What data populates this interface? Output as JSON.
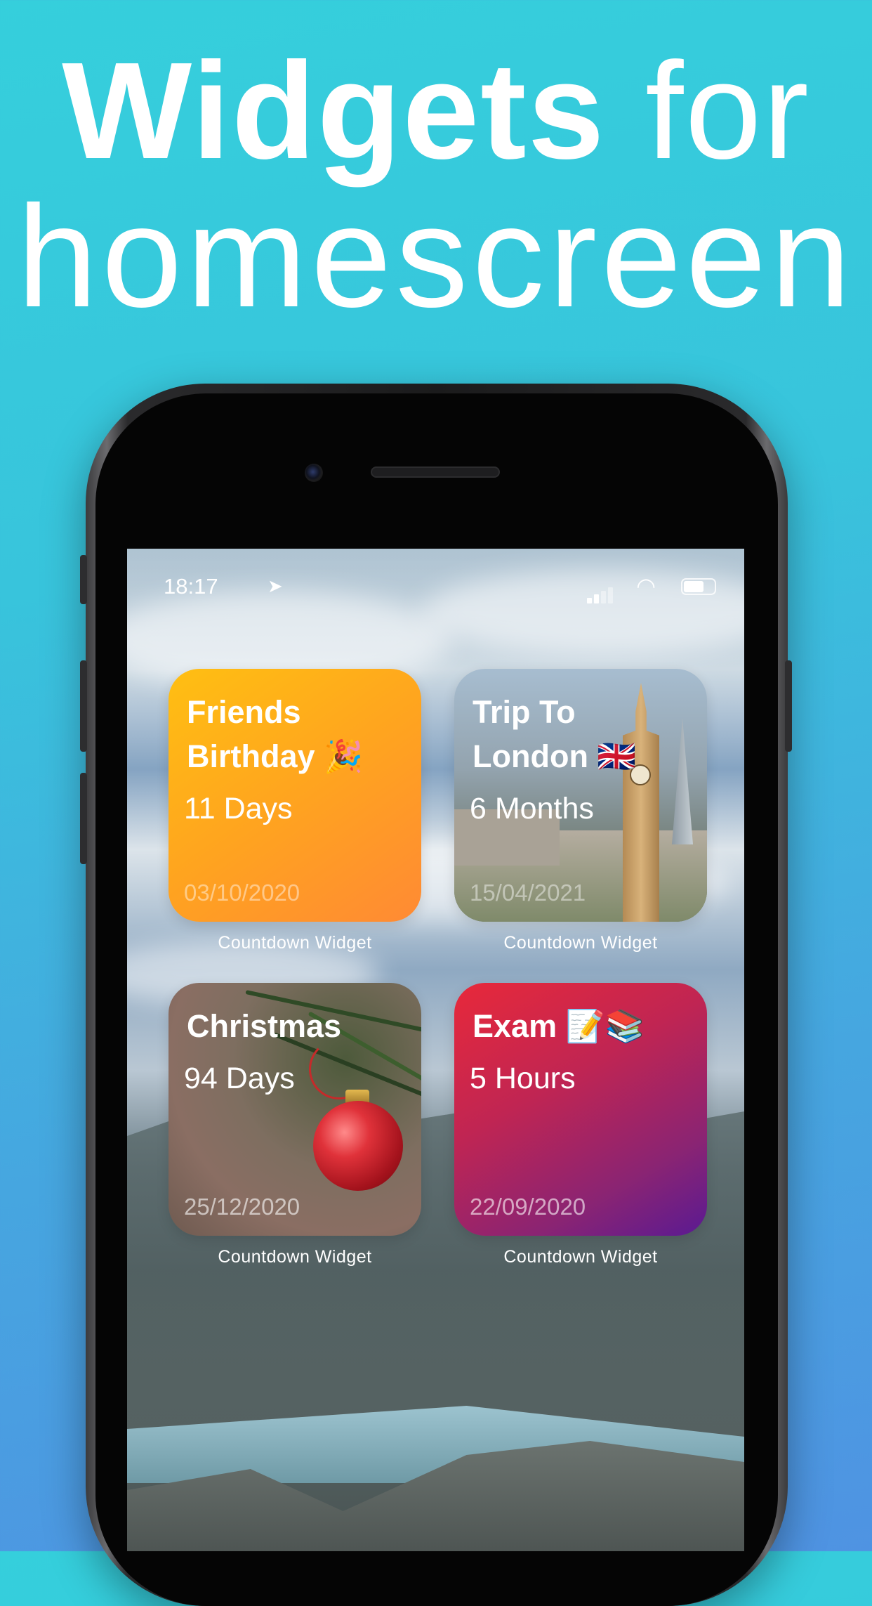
{
  "headline": {
    "bold": "Widgets",
    "regular": "for",
    "line2": "homescreen"
  },
  "status_bar": {
    "time": "18:17"
  },
  "widgets": [
    {
      "title_line1": "Friends",
      "title_line2": "Birthday 🎉",
      "count": "11 Days",
      "date": "03/10/2020",
      "caption": "Countdown Widget"
    },
    {
      "title_line1": "Trip To",
      "title_line2": "London 🇬🇧",
      "count": "6 Months",
      "date": "15/04/2021",
      "caption": "Countdown Widget"
    },
    {
      "title_line1": "Christmas",
      "title_line2": "",
      "count": "94 Days",
      "date": "25/12/2020",
      "caption": "Countdown Widget"
    },
    {
      "title_line1": "Exam 📝📚",
      "title_line2": "",
      "count": "5 Hours",
      "date": "22/09/2020",
      "caption": "Countdown Widget"
    }
  ],
  "icons": {
    "location": "location-arrow-icon",
    "signal": "cellular-signal-icon",
    "wifi": "wifi-icon",
    "battery": "battery-icon"
  }
}
